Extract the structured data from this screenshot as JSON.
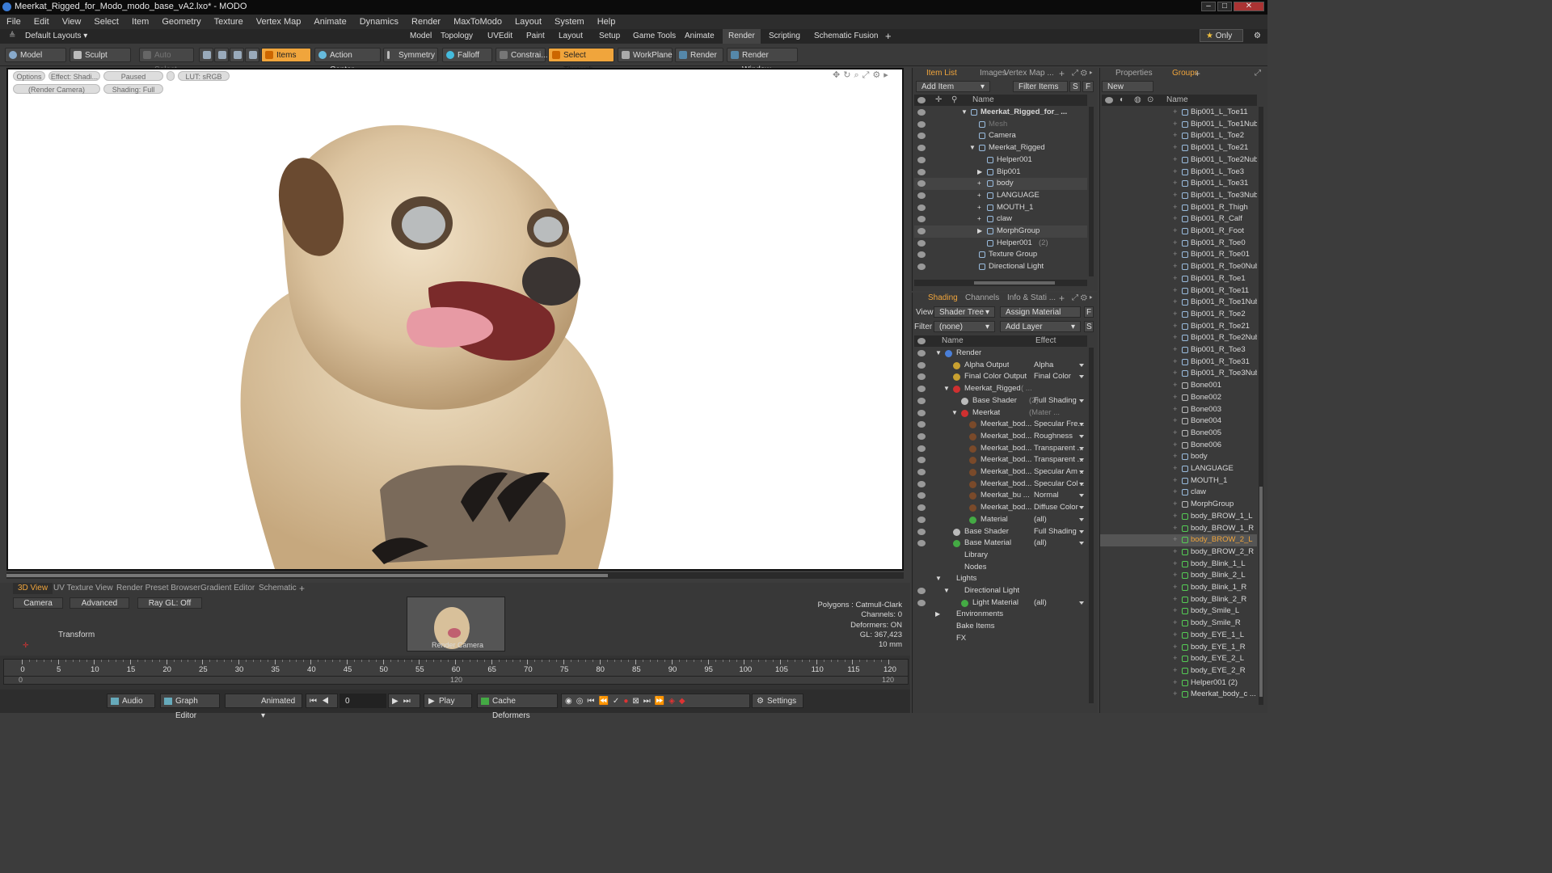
{
  "window": {
    "title": "Meerkat_Rigged_for_Modo_modo_base_vA2.lxo* - MODO"
  },
  "menu": [
    "File",
    "Edit",
    "View",
    "Select",
    "Item",
    "Geometry",
    "Texture",
    "Vertex Map",
    "Animate",
    "Dynamics",
    "Render",
    "MaxToModo",
    "Layout",
    "System",
    "Help"
  ],
  "layouts": {
    "default": "Default Layouts ▾",
    "tabs": [
      "Model",
      "Topology",
      "UVEdit",
      "Paint",
      "Layout",
      "Setup",
      "Game Tools",
      "Animate",
      "Render",
      "Scripting",
      "Schematic Fusion"
    ],
    "active": "Render",
    "plus": "+",
    "only": "Only"
  },
  "toolbar": {
    "model": "Model",
    "sculpt": "Sculpt",
    "auto_select": "Auto Select",
    "items": "Items",
    "action_center": "Action Center",
    "symmetry": "Symmetry",
    "falloff": "Falloff",
    "constraints": "Constrai...",
    "select_through": "Select Through",
    "workplane": "WorkPlane",
    "render": "Render",
    "render_window": "Render Window"
  },
  "viewport": {
    "options": "Options",
    "effect": "Effect: Shadi...",
    "paused": "Paused",
    "lut": "LUT: sRGB",
    "render_camera": "(Render Camera)",
    "shading": "Shading: Full"
  },
  "bottom": {
    "tabs": [
      "3D View",
      "UV Texture View",
      "Render Preset Browser",
      "Gradient Editor",
      "Schematic"
    ],
    "active": "3D View",
    "plus": "+",
    "camera": "Camera",
    "advanced": "Advanced",
    "raygl": "Ray GL: Off",
    "transform": "Transform",
    "thumb_label": "Render Camera",
    "stats": [
      "Polygons : Catmull-Clark",
      "Channels: 0",
      "Deformers: ON",
      "GL: 367,423",
      "10 mm"
    ]
  },
  "timeline": {
    "ticks": [
      0,
      5,
      10,
      15,
      20,
      25,
      30,
      35,
      40,
      45,
      50,
      55,
      60,
      65,
      70,
      75,
      80,
      85,
      90,
      95,
      100,
      105,
      110,
      115,
      120
    ],
    "sub": [
      "0",
      "120",
      "120"
    ]
  },
  "playbar": {
    "audio": "Audio",
    "graph_editor": "Graph Editor",
    "animated": "Animated",
    "frame": "0",
    "play": "Play",
    "cache": "Cache Deformers",
    "settings": "Settings"
  },
  "itemlist": {
    "tabs": [
      "Item List",
      "Images",
      "Vertex Map ..."
    ],
    "active": "Item List",
    "plus": "+",
    "add_item": "Add Item",
    "filter_items": "Filter Items",
    "s": "S",
    "f": "F",
    "header": "Name",
    "rows": [
      {
        "label": "Meerkat_Rigged_for_ ...",
        "indent": 0,
        "bold": true,
        "exp": "▼"
      },
      {
        "label": "Mesh",
        "indent": 1,
        "dim": true
      },
      {
        "label": "Camera",
        "indent": 1
      },
      {
        "label": "Meerkat_Rigged",
        "indent": 1,
        "exp": "▼"
      },
      {
        "label": "Helper001",
        "indent": 2
      },
      {
        "label": "Bip001",
        "indent": 2,
        "exp": "▶"
      },
      {
        "label": "body",
        "indent": 2,
        "exp": "+",
        "hl": true
      },
      {
        "label": "LANGUAGE",
        "indent": 2,
        "exp": "+"
      },
      {
        "label": "MOUTH_1",
        "indent": 2,
        "exp": "+"
      },
      {
        "label": "claw",
        "indent": 2,
        "exp": "+"
      },
      {
        "label": "MorphGroup",
        "indent": 2,
        "exp": "▶",
        "hl": true
      },
      {
        "label": "Helper001",
        "suffix": "(2)",
        "indent": 2
      },
      {
        "label": "Texture Group",
        "indent": 1
      },
      {
        "label": "Directional Light",
        "indent": 1
      }
    ]
  },
  "shading": {
    "tabs": [
      "Shading",
      "Channels",
      "Info & Stati ..."
    ],
    "active": "Shading",
    "plus": "+",
    "view_label": "View",
    "view": "Shader Tree",
    "assign": "Assign Material",
    "filter_label": "Filter",
    "filter": "(none)",
    "add_layer": "Add Layer",
    "f": "F",
    "s": "S",
    "col_name": "Name",
    "col_effect": "Effect",
    "rows": [
      {
        "label": "Render",
        "indent": 0,
        "effect": "",
        "ball": "#4a7fd8",
        "exp": "▼"
      },
      {
        "label": "Alpha Output",
        "indent": 1,
        "effect": "Alpha",
        "ball": "#c8a030"
      },
      {
        "label": "Final Color Output",
        "indent": 1,
        "effect": "Final Color",
        "ball": "#c8a030"
      },
      {
        "label": "Meerkat_Rigged",
        "suffix": "( ...",
        "indent": 1,
        "effect": "",
        "ball": "#d03030",
        "exp": "▼"
      },
      {
        "label": "Base Shader",
        "suffix": "(2)",
        "indent": 2,
        "effect": "Full Shading",
        "ball": "#bbbbbb"
      },
      {
        "label": "Meerkat",
        "suffix": "(Mater ...",
        "indent": 2,
        "effect": "",
        "ball": "#d03030",
        "exp": "▼"
      },
      {
        "label": "Meerkat_bod...",
        "indent": 3,
        "effect": "Specular Fre...",
        "ball": "#7a4a2a"
      },
      {
        "label": "Meerkat_bod...",
        "indent": 3,
        "effect": "Roughness",
        "ball": "#7a4a2a"
      },
      {
        "label": "Meerkat_bod...",
        "indent": 3,
        "effect": "Transparent ...",
        "ball": "#7a4a2a"
      },
      {
        "label": "Meerkat_bod...",
        "indent": 3,
        "effect": "Transparent ...",
        "ball": "#7a4a2a"
      },
      {
        "label": "Meerkat_bod...",
        "indent": 3,
        "effect": "Specular Am ...",
        "ball": "#7a4a2a"
      },
      {
        "label": "Meerkat_bod...",
        "indent": 3,
        "effect": "Specular Col ...",
        "ball": "#7a4a2a"
      },
      {
        "label": "Meerkat_bu ...",
        "indent": 3,
        "effect": "Normal",
        "ball": "#7a4a2a"
      },
      {
        "label": "Meerkat_bod...",
        "indent": 3,
        "effect": "Diffuse Color",
        "ball": "#7a4a2a"
      },
      {
        "label": "Material",
        "indent": 3,
        "effect": "(all)",
        "ball": "#44aa44"
      },
      {
        "label": "Base Shader",
        "indent": 1,
        "effect": "Full Shading",
        "ball": "#bbbbbb"
      },
      {
        "label": "Base Material",
        "indent": 1,
        "effect": "(all)",
        "ball": "#44aa44"
      },
      {
        "label": "Library",
        "indent": 1,
        "effect": ""
      },
      {
        "label": "Nodes",
        "indent": 1,
        "effect": ""
      },
      {
        "label": "Lights",
        "indent": 0,
        "effect": "",
        "exp": "▼"
      },
      {
        "label": "Directional Light",
        "indent": 1,
        "effect": "",
        "exp": "▼"
      },
      {
        "label": "Light Material",
        "indent": 2,
        "effect": "(all)",
        "ball": "#44aa44"
      },
      {
        "label": "Environments",
        "indent": 0,
        "effect": "",
        "exp": "▶"
      },
      {
        "label": "Bake Items",
        "indent": 0,
        "effect": ""
      },
      {
        "label": "FX",
        "indent": 0,
        "effect": ""
      }
    ]
  },
  "groups": {
    "tabs": [
      "Properties",
      "Groups"
    ],
    "active": "Groups",
    "plus": "+",
    "new_group": "New Group",
    "header": "Name",
    "rows": [
      "Bip001_L_Toe11",
      "Bip001_L_Toe1Nub",
      "Bip001_L_Toe2",
      "Bip001_L_Toe21",
      "Bip001_L_Toe2Nub",
      "Bip001_L_Toe3",
      "Bip001_L_Toe31",
      "Bip001_L_Toe3Nub",
      "Bip001_R_Thigh",
      "Bip001_R_Calf",
      "Bip001_R_Foot",
      "Bip001_R_Toe0",
      "Bip001_R_Toe01",
      "Bip001_R_Toe0Nub",
      "Bip001_R_Toe1",
      "Bip001_R_Toe11",
      "Bip001_R_Toe1Nub",
      "Bip001_R_Toe2",
      "Bip001_R_Toe21",
      "Bip001_R_Toe2Nub",
      "Bip001_R_Toe3",
      "Bip001_R_Toe31",
      "Bip001_R_Toe3Nub",
      "Bone001",
      "Bone002",
      "Bone003",
      "Bone004",
      "Bone005",
      "Bone006",
      "body",
      "LANGUAGE",
      "MOUTH_1",
      "claw",
      "MorphGroup",
      "body_BROW_1_L",
      "body_BROW_1_R",
      "body_BROW_2_L",
      "body_BROW_2_R",
      "body_Blink_1_L",
      "body_Blink_2_L",
      "body_Blink_1_R",
      "body_Blink_2_R",
      "body_Smile_L",
      "body_Smile_R",
      "body_EYE_1_L",
      "body_EYE_1_R",
      "body_EYE_2_L",
      "body_EYE_2_R",
      "Helper001 (2)",
      "Meerkat_body_c ..."
    ],
    "selected": "body_BROW_2_L"
  }
}
